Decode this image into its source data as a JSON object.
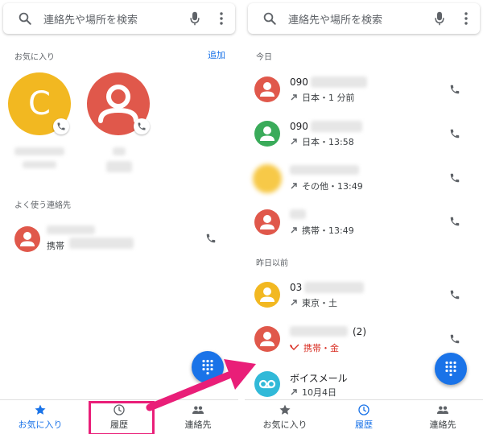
{
  "search_placeholder": "連絡先や場所を検索",
  "left_panel": {
    "favorites_label": "お気に入り",
    "add_label": "追加",
    "favorite_1_letter": "C",
    "frequent_label": "よく使う連絡先",
    "frequent_contact_type": "携帯"
  },
  "right_panel": {
    "today_label": "今日",
    "earlier_label": "昨日以前",
    "calls": [
      {
        "number": "090",
        "detail": "日本・1 分前",
        "avatar_color": "#e0584b"
      },
      {
        "number": "090",
        "detail": "日本・13:58",
        "avatar_color": "#3aab5a"
      },
      {
        "number": "",
        "detail": "その他・13:49",
        "avatar_color": "#f7c948"
      },
      {
        "number": "",
        "detail": "携帯・13:49",
        "avatar_color": "#e0584b"
      },
      {
        "number": "03",
        "detail": "東京・土",
        "avatar_color": "#f2b821"
      },
      {
        "number": "",
        "count": "(2)",
        "detail": "携帯・金",
        "avatar_color": "#e0584b"
      },
      {
        "number": "ボイスメール",
        "detail": "10月4日",
        "avatar_color": "#31b9d8"
      }
    ]
  },
  "nav": {
    "favorites": "お気に入り",
    "history": "履歴",
    "contacts": "連絡先"
  },
  "colors": {
    "accent": "#1a73e8",
    "highlight": "#e91e78",
    "favorite_1": "#f2b821",
    "favorite_2": "#e0584b"
  }
}
